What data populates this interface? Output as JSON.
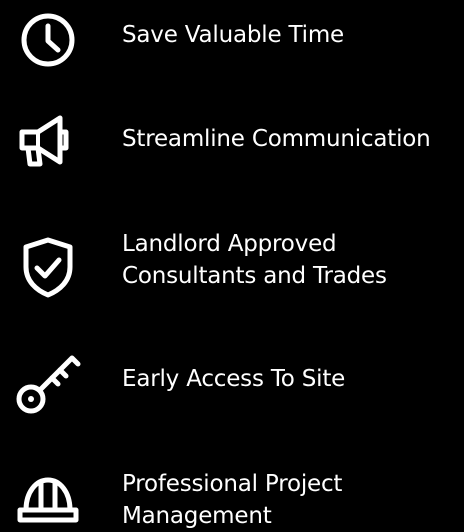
{
  "features": [
    {
      "icon": "clock-icon",
      "lines": [
        "Save Valuable Time"
      ]
    },
    {
      "icon": "megaphone-icon",
      "lines": [
        "Streamline Communication"
      ]
    },
    {
      "icon": "shield-check-icon",
      "lines": [
        "Landlord Approved",
        "Consultants and Trades"
      ]
    },
    {
      "icon": "key-icon",
      "lines": [
        "Early Access To Site"
      ]
    },
    {
      "icon": "hard-hat-icon",
      "lines": [
        "Professional Project",
        "Management"
      ]
    }
  ],
  "colors": {
    "background": "#000000",
    "foreground": "#ffffff"
  }
}
